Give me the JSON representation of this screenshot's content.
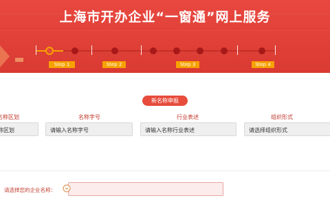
{
  "banner": {
    "title": "上海市开办企业“一窗通”网上服务"
  },
  "steps": [
    {
      "label": "Step 1"
    },
    {
      "label": "Step 2"
    },
    {
      "label": "Step 3"
    },
    {
      "label": "Step 4"
    }
  ],
  "colors": {
    "banner_red": "#d93a32",
    "step_orange": "#f7a200",
    "dot_dark": "#a71919",
    "label_red": "#c0392b"
  },
  "form": {
    "section_button": "新名称申报",
    "columns": [
      {
        "label": "名称区划",
        "value": "称区划"
      },
      {
        "label": "名称字号",
        "value": "请输入名称字号"
      },
      {
        "label": "行业表述",
        "value": "请输入名称行业表述"
      },
      {
        "label": "组织形式",
        "value": "请选择组织形式"
      }
    ]
  },
  "question": {
    "label": "请选择您的企业名称：",
    "value": ""
  }
}
